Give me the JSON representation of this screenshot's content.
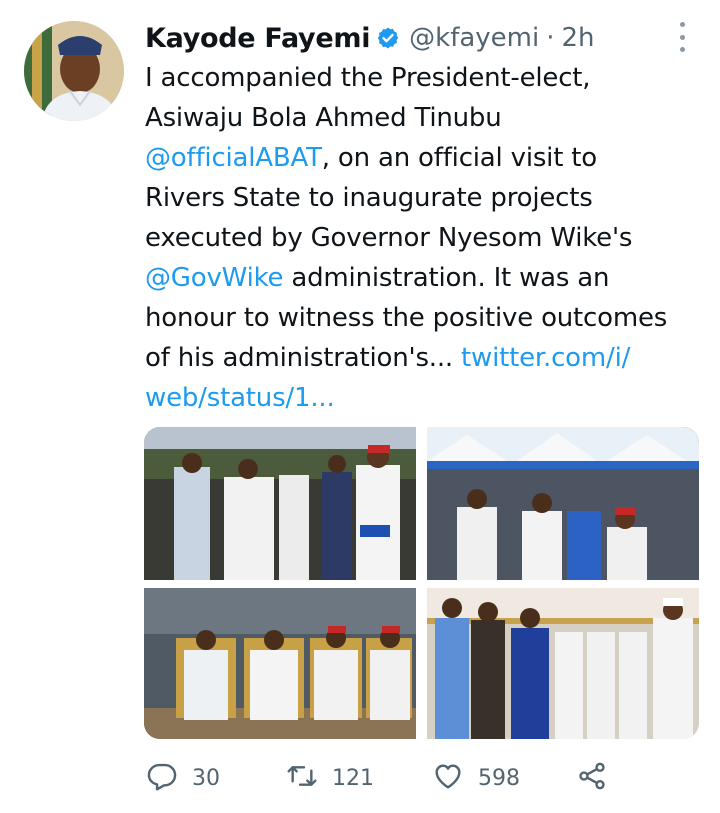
{
  "tweet": {
    "author": {
      "name": "Kayode Fayemi",
      "handle": "@kfayemi",
      "verified": true
    },
    "separator": "·",
    "time": "2h",
    "text_lines": [
      [
        {
          "t": "I accompanied the President-elect,",
          "link": false
        }
      ],
      [
        {
          "t": "Asiwaju Bola Ahmed Tinubu",
          "link": false
        }
      ],
      [
        {
          "t": "@officialABAT",
          "link": true
        },
        {
          "t": ", on an official visit to",
          "link": false
        }
      ],
      [
        {
          "t": "Rivers State to inaugurate projects",
          "link": false
        }
      ],
      [
        {
          "t": "executed by Governor Nyesom Wike's",
          "link": false
        }
      ],
      [
        {
          "t": "@GovWike",
          "link": true
        },
        {
          "t": " administration. It was an",
          "link": false
        }
      ],
      [
        {
          "t": "honour to witness the positive outcomes",
          "link": false
        }
      ],
      [
        {
          "t": "of his administration's... ",
          "link": false
        },
        {
          "t": "twitter.com/i/",
          "link": true
        }
      ],
      [
        {
          "t": "web/status/1...",
          "link": true
        }
      ]
    ],
    "media": [
      {
        "name": "photo-stage-handshake"
      },
      {
        "name": "photo-crowd-greeting"
      },
      {
        "name": "photo-seated-dignitaries"
      },
      {
        "name": "photo-group-standing"
      }
    ],
    "actions": {
      "replies": "30",
      "retweets": "121",
      "likes": "598"
    },
    "colors": {
      "link": "#1d9bf0",
      "verified": "#1d9bf0",
      "secondary_text": "#536471"
    }
  }
}
